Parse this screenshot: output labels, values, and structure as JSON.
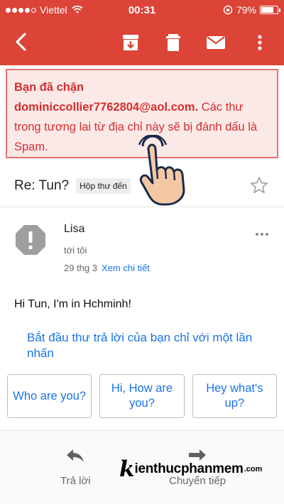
{
  "status_bar": {
    "carrier": "Viettel",
    "time": "00:31",
    "battery": "79%",
    "battery_level": 0.79
  },
  "toolbar": {
    "back_icon": "back-arrow-icon",
    "archive_icon": "archive-icon",
    "delete_icon": "trash-icon",
    "mark_icon": "envelope-icon",
    "more_icon": "more-vertical-icon"
  },
  "blocked_notice": {
    "prefix": "Bạn đã chặn",
    "email": "dominiccollier7762804@aol.com.",
    "message": " Các thư trong tương lai từ địa chỉ này sẽ bị đánh dấu là Spam."
  },
  "thread": {
    "subject": "Re: Tun?",
    "label": "Hộp thư đến"
  },
  "message": {
    "sender": "Lisa",
    "to": "tới tôi",
    "date": "29 thg 3",
    "details_link": "Xem chi tiết",
    "body": "Hi Tun, I'm in Hchminh!"
  },
  "smart_reply": {
    "hint": "Bắt đầu thư trả lời của bạn chỉ với một lần nhấn",
    "options": [
      "Who are you?",
      "Hi, How are you?",
      "Hey what's up?"
    ]
  },
  "bottom_actions": {
    "reply": "Trả lời",
    "forward": "Chuyển tiếp"
  },
  "watermark": {
    "k": "k",
    "rest": "ienthucphanmem",
    "com": ".com"
  },
  "colors": {
    "accent": "#db4437",
    "link": "#1a73e8",
    "notice_text": "#d32f2f",
    "notice_bg": "#fbe9e7"
  }
}
